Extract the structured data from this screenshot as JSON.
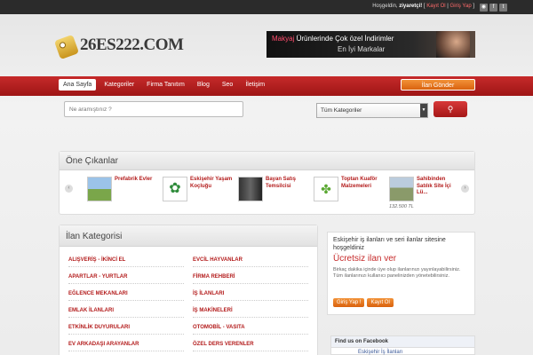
{
  "topbar": {
    "welcome": "Hoşgeldin,",
    "user": "ziyaretçi!",
    "register": "Kayıt Ol",
    "login": "Giriş Yap"
  },
  "logo": {
    "text": "26ES222.COM"
  },
  "banner": {
    "line1_a": "Makyaj",
    "line1_b": "Ürünlerinde Çok özel İndirimler",
    "line2": "En İyi Markalar"
  },
  "nav": {
    "items": [
      "Ana Sayfa",
      "Kategoriler",
      "Firma Tanıtım",
      "Blog",
      "Seo",
      "İletişim"
    ],
    "post_button": "İlan Gönder"
  },
  "search": {
    "placeholder": "Ne aramıştınız ?",
    "category_selected": "Tüm Kategoriler",
    "button_icon": "search-icon"
  },
  "featured": {
    "title": "Öne Çıkanlar",
    "items": [
      {
        "title": "Prefabrik Evler",
        "price": ""
      },
      {
        "title": "Eskişehir Yaşam Koçluğu",
        "price": ""
      },
      {
        "title": "Bayan Satış Temsilcisi",
        "price": ""
      },
      {
        "title": "Toptan Kuaför Malzemeleri",
        "price": ""
      },
      {
        "title": "Sahibinden Satılık Site İçi Lü...",
        "price": "132.500 TL"
      }
    ]
  },
  "categories": {
    "title": "İlan Kategorisi",
    "left": [
      "ALIŞVERİŞ - İKİNCİ EL",
      "APARTLAR - YURTLAR",
      "EĞLENCE MEKANLARI",
      "EMLAK İLANLARI",
      "ETKİNLİK DUYURULARI",
      "EV ARKADAŞI ARAYANLAR"
    ],
    "right": [
      "EVCİL HAYVANLAR",
      "FİRMA REHBERİ",
      "İŞ İLANLARI",
      "İŞ MAKİNELERİ",
      "OTOMOBİL - VASITA",
      "ÖZEL DERS VERENLER"
    ]
  },
  "info": {
    "line1": "Eskişehir iş ilanları ve seri ilanlar sitesine hoşgeldiniz",
    "line2": "Ücretsiz ilan ver",
    "line3": "Birkaç dakika içinde üye olup ilanlarınızı yayınlayabilirsiniz. Tüm ilanlarınızı kullanıcı panelinizden yönetebilirsiniz.",
    "login": "Giriş Yap !",
    "register": "Kayıt Ol"
  },
  "facebook": {
    "title": "Find us on Facebook",
    "page": "Eskişehir İş İlanları"
  }
}
